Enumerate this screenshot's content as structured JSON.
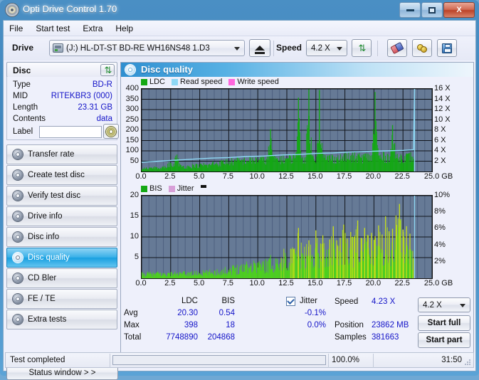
{
  "window": {
    "title": "Opti Drive Control 1.70",
    "icon": "disc-icon",
    "controls": {
      "minimize": "minimize-icon",
      "maximize": "maximize-icon",
      "close": "X"
    }
  },
  "menu": {
    "items": [
      "File",
      "Start test",
      "Extra",
      "Help"
    ]
  },
  "toolbar": {
    "drive_label": "Drive",
    "drive_value": "(J:)  HL-DT-ST BD-RE  WH16NS48 1.D3",
    "eject_icon": "eject-icon",
    "speed_label": "Speed",
    "speed_value": "4.2 X",
    "refresh_icon": "refresh-icon",
    "eraser_icon": "eraser-icon",
    "settings_icon": "gear-icon",
    "save_icon": "save-icon"
  },
  "disc": {
    "title": "Disc",
    "refresh_icon": "refresh-icon",
    "rows": [
      {
        "key": "Type",
        "value": "BD-R"
      },
      {
        "key": "MID",
        "value": "RITEKBR3 (000)"
      },
      {
        "key": "Length",
        "value": "23.31 GB"
      },
      {
        "key": "Contents",
        "value": "data"
      }
    ],
    "label_key": "Label",
    "label_value": "",
    "label_placeholder": "",
    "disc_icon": "cd-icon"
  },
  "sidebar": {
    "items": [
      {
        "label": "Transfer rate",
        "icon": "disc-icon",
        "active": false
      },
      {
        "label": "Create test disc",
        "icon": "disc-icon",
        "active": false
      },
      {
        "label": "Verify test disc",
        "icon": "disc-icon",
        "active": false
      },
      {
        "label": "Drive info",
        "icon": "disc-icon",
        "active": false
      },
      {
        "label": "Disc info",
        "icon": "disc-icon",
        "active": false
      },
      {
        "label": "Disc quality",
        "icon": "disc-icon",
        "active": true
      },
      {
        "label": "CD Bler",
        "icon": "disc-icon",
        "active": false
      },
      {
        "label": "FE / TE",
        "icon": "disc-icon",
        "active": false
      },
      {
        "label": "Extra tests",
        "icon": "disc-icon",
        "active": false
      }
    ],
    "status_window_button": "Status window > >"
  },
  "main": {
    "header": "Disc quality",
    "header_icon": "disc-icon"
  },
  "stats": {
    "col_ldc": "LDC",
    "col_bis": "BIS",
    "rows": [
      {
        "name": "Avg",
        "ldc": "20.30",
        "bis": "0.54",
        "jitter": "-0.1%"
      },
      {
        "name": "Max",
        "ldc": "398",
        "bis": "18",
        "jitter": "0.0%"
      },
      {
        "name": "Total",
        "ldc": "7748890",
        "bis": "204868",
        "jitter": ""
      }
    ],
    "jitter_label": "Jitter",
    "jitter_checked": true,
    "speed_key": "Speed",
    "speed_value": "4.23 X",
    "position_key": "Position",
    "position_value": "23862 MB",
    "samples_key": "Samples",
    "samples_value": "381663",
    "speed_select": "4.2 X",
    "start_full": "Start full",
    "start_part": "Start part"
  },
  "statusbar": {
    "text": "Test completed",
    "percent": "100.0%",
    "progress": 100,
    "time": "31:50"
  },
  "colors": {
    "ldc": "#14a814",
    "bis": "#4cd21c",
    "jitter": "#d8a0d8",
    "read_speed": "#8fd8f5",
    "write_speed": "#ff66dd",
    "plot_bg": "#667a96",
    "grid": "#11151c",
    "accent": "#1414c8"
  },
  "chart_data": [
    {
      "type": "area",
      "id": "ldc-chart",
      "title": "",
      "xlabel": "GB",
      "ylabel": "",
      "xlim": [
        0,
        25
      ],
      "ylim": [
        0,
        400
      ],
      "y2lim": [
        0,
        16
      ],
      "y2label": "X",
      "grid": true,
      "legend": [
        {
          "label": "LDC",
          "color": "#14a814"
        },
        {
          "label": "Read speed",
          "color": "#8fd8f5"
        },
        {
          "label": "Write speed",
          "color": "#ff66dd"
        }
      ],
      "xticks": [
        "0.0",
        "2.5",
        "5.0",
        "7.5",
        "10.0",
        "12.5",
        "15.0",
        "17.5",
        "20.0",
        "22.5",
        "25.0"
      ],
      "yticks": [
        400,
        350,
        300,
        250,
        200,
        150,
        100,
        50
      ],
      "y2ticks": [
        "16 X",
        "14 X",
        "12 X",
        "10 X",
        "8 X",
        "6 X",
        "4 X",
        "2 X"
      ],
      "series": [
        {
          "name": "LDC",
          "color": "#14a814",
          "x": [
            0.0,
            0.3,
            0.6,
            0.9,
            1.2,
            1.5,
            1.8,
            2.1,
            2.4,
            2.7,
            3.0,
            3.3,
            3.6,
            3.9,
            4.2,
            4.5,
            4.8,
            5.1,
            5.4,
            5.7,
            6.0,
            6.3,
            6.6,
            6.9,
            7.2,
            7.5,
            7.8,
            8.1,
            8.4,
            8.7,
            9.0,
            9.3,
            9.6,
            9.9,
            10.2,
            10.5,
            10.8,
            11.1,
            11.4,
            11.7,
            12.0,
            12.3,
            12.6,
            12.9,
            13.2,
            13.5,
            13.8,
            14.1,
            14.4,
            14.7,
            15.0,
            15.3,
            15.6,
            15.9,
            16.2,
            16.5,
            16.8,
            17.1,
            17.4,
            17.7,
            18.0,
            18.3,
            18.6,
            18.9,
            19.2,
            19.5,
            19.8,
            20.1,
            20.4,
            20.7,
            21.0,
            21.3,
            21.6,
            21.9,
            22.2,
            22.5,
            22.8,
            23.1,
            23.4
          ],
          "values": [
            22,
            26,
            24,
            30,
            28,
            26,
            32,
            30,
            55,
            35,
            108,
            40,
            36,
            34,
            38,
            45,
            40,
            42,
            50,
            38,
            55,
            60,
            58,
            62,
            70,
            68,
            72,
            70,
            78,
            74,
            80,
            82,
            78,
            84,
            86,
            82,
            88,
            205,
            86,
            90,
            88,
            92,
            90,
            96,
            94,
            358,
            92,
            96,
            398,
            94,
            92,
            395,
            96,
            92,
            98,
            94,
            96,
            92,
            100,
            106,
            98,
            100,
            102,
            98,
            104,
            100,
            102,
            385,
            104,
            100,
            106,
            102,
            225,
            104,
            100,
            106,
            102,
            104,
            100
          ]
        },
        {
          "name": "Read speed",
          "color": "#8fd8f5",
          "x": [
            0.0,
            1.5,
            3.0,
            4.5,
            6.0,
            7.5,
            9.0,
            10.5,
            12.0,
            13.5,
            15.0,
            16.5,
            18.0,
            19.5,
            21.0,
            22.5,
            23.4,
            23.5
          ],
          "values": [
            1.8,
            2.0,
            2.2,
            2.4,
            2.6,
            2.7,
            2.9,
            3.0,
            3.2,
            3.3,
            3.5,
            3.6,
            3.8,
            3.9,
            4.0,
            4.1,
            4.2,
            16.0
          ]
        }
      ]
    },
    {
      "type": "area",
      "id": "bis-chart",
      "title": "",
      "xlabel": "GB",
      "ylabel": "",
      "xlim": [
        0,
        25
      ],
      "ylim": [
        0,
        20
      ],
      "y2lim": [
        0,
        10
      ],
      "y2label": "%",
      "grid": true,
      "legend": [
        {
          "label": "BIS",
          "color": "#14a814"
        },
        {
          "label": "Jitter",
          "color": "#d8a0d8"
        }
      ],
      "xticks": [
        "0.0",
        "2.5",
        "5.0",
        "7.5",
        "10.0",
        "12.5",
        "15.0",
        "17.5",
        "20.0",
        "22.5",
        "25.0"
      ],
      "yticks": [
        20,
        15,
        10,
        5
      ],
      "y2ticks": [
        "10%",
        "8%",
        "6%",
        "4%",
        "2%"
      ],
      "series": [
        {
          "name": "BIS",
          "color": "#4cd21c",
          "x": [
            0.0,
            0.3,
            0.6,
            0.9,
            1.2,
            1.5,
            1.8,
            2.1,
            2.4,
            2.7,
            3.0,
            3.3,
            3.6,
            3.9,
            4.2,
            4.5,
            4.8,
            5.1,
            5.4,
            5.7,
            6.0,
            6.3,
            6.6,
            6.9,
            7.2,
            7.5,
            7.8,
            8.1,
            8.4,
            8.7,
            9.0,
            9.3,
            9.6,
            9.9,
            10.2,
            10.5,
            10.8,
            11.1,
            11.4,
            11.7,
            12.0,
            12.3,
            12.6,
            12.9,
            13.2,
            13.5,
            13.8,
            14.1,
            14.4,
            14.7,
            15.0,
            15.3,
            15.6,
            15.9,
            16.2,
            16.5,
            16.8,
            17.1,
            17.4,
            17.7,
            18.0,
            18.3,
            18.6,
            18.9,
            19.2,
            19.5,
            19.8,
            20.1,
            20.4,
            20.7,
            21.0,
            21.3,
            21.6,
            21.9,
            22.2,
            22.5,
            22.8,
            23.1,
            23.4
          ],
          "values": [
            1.6,
            1.4,
            1.7,
            1.5,
            1.6,
            1.8,
            1.5,
            1.7,
            1.6,
            1.8,
            1.7,
            1.6,
            1.8,
            1.7,
            1.9,
            1.8,
            2.0,
            1.9,
            2.1,
            2.0,
            2.4,
            2.2,
            2.6,
            2.5,
            2.8,
            3.2,
            3.4,
            3.6,
            4.0,
            3.8,
            5.6,
            4.4,
            4.8,
            5.2,
            5.0,
            4.6,
            5.4,
            5.8,
            5.2,
            6.0,
            5.6,
            7.8,
            8.0,
            7.6,
            8.2,
            12.2,
            8.0,
            8.6,
            9.2,
            8.4,
            11.6,
            8.8,
            10.4,
            9.0,
            9.4,
            12.6,
            9.2,
            9.8,
            13.0,
            9.6,
            11.2,
            10.0,
            14.0,
            9.8,
            12.2,
            10.4,
            11.0,
            10.2,
            12.8,
            10.6,
            15.0,
            11.4,
            12.0,
            15.2,
            18.0,
            11.8,
            12.6,
            10.8,
            6.0
          ]
        }
      ]
    }
  ]
}
